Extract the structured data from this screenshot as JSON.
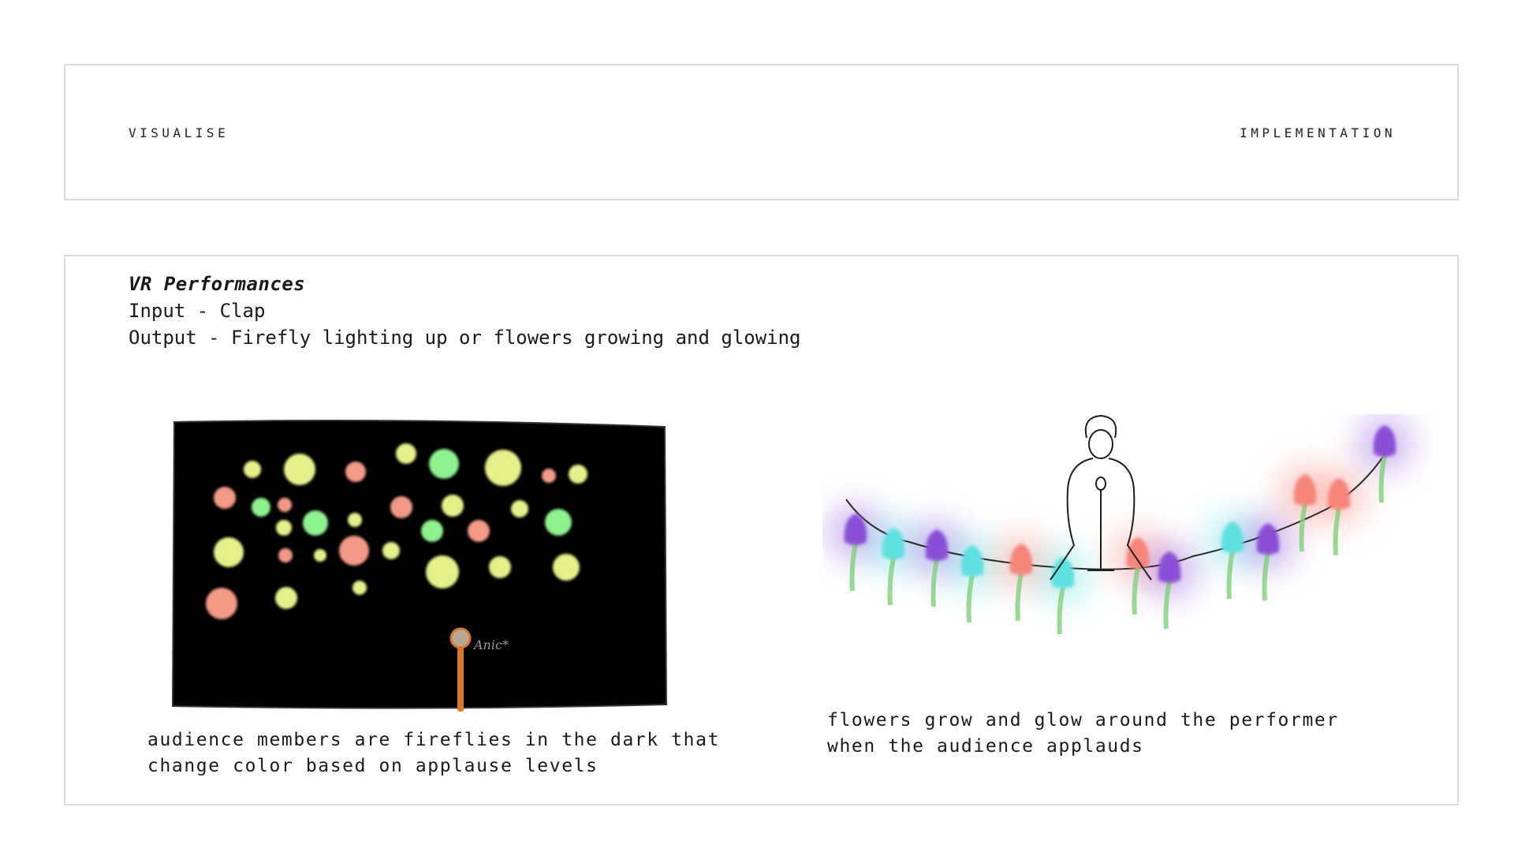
{
  "header": {
    "left_label": "VISUALISE",
    "right_label": "IMPLEMENTATION"
  },
  "intro": {
    "title": "VR Performances",
    "input_line": "Input - Clap",
    "output_line": "Output - Firefly lighting up or flowers growing and glowing"
  },
  "sketches": {
    "fireflies": {
      "caption_line1": "audience members are fireflies in the dark that",
      "caption_line2": "change color based on applause levels",
      "mic_scribble": "Anic*",
      "colors": {
        "background": "#000000",
        "yellow": "#e6f08a",
        "green": "#8ef28f",
        "salmon": "#f39a86",
        "mic_stand": "#d9772e"
      }
    },
    "flowers": {
      "caption_line1": "flowers grow and glow around the performer",
      "caption_line2": "when the audience applauds",
      "colors": {
        "purple": "#8a4fd6",
        "cyan": "#5fe0e0",
        "pink": "#f6857a",
        "stem": "#7fcf7a"
      }
    }
  }
}
